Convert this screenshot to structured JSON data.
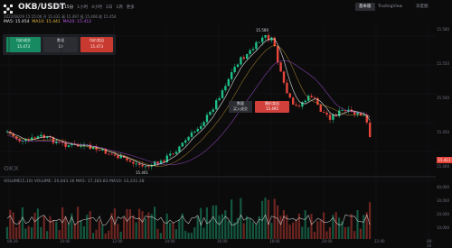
{
  "header": {
    "pair": "OKB/USDT",
    "timeframes": [
      "分时",
      "15分",
      "1小时",
      "4小时",
      "1日",
      "1周",
      "更多"
    ],
    "selected_timeframe": "15分",
    "right_tabs": [
      "基本版",
      "TradingView",
      "深度图"
    ],
    "ohlc": "2022/08/29 15:15:00  开 15.431  高 15.497  低 15.406  收 15.454",
    "ma": {
      "ma5": "MA5: 15.454",
      "ma10": "MA10: 15.441",
      "ma20": "MA20: 15.412"
    }
  },
  "order_panel": {
    "left": {
      "title": "均价成交",
      "value": "15.473"
    },
    "mid": {
      "title": "数量",
      "value": "10"
    },
    "right": {
      "title": "均价卖出",
      "value": "15.473"
    }
  },
  "annotations": {
    "high": "15.580",
    "low": "15.401",
    "buy_tip": {
      "title": "数量",
      "value": "买入成交"
    },
    "sell_tip": {
      "title": "限价卖出",
      "value": "15.495"
    },
    "last_price": "15.411"
  },
  "watermark": "OKX",
  "volume": {
    "label": "VOLUME(5,10)  VOLUME: 20,043.16   MA5: 17,183.83   MA10: 13,231.28"
  },
  "price_axis": [
    "15.580",
    "15.550",
    "15.500",
    "15.450",
    "15.400"
  ],
  "volume_axis": [
    "40,000",
    "30,000",
    "20,000",
    "10,000"
  ],
  "time_axis": [
    "08-29",
    "10:00",
    "12:00",
    "14:00",
    "16:00",
    "18:00",
    "20:00",
    "22:00",
    "08-30"
  ],
  "colors": {
    "up": "#1fbf87",
    "down": "#e6453a",
    "ma5": "#ffffff",
    "ma10": "#e8b73a",
    "ma20": "#b659e6",
    "bg": "#0b0b0c"
  }
}
